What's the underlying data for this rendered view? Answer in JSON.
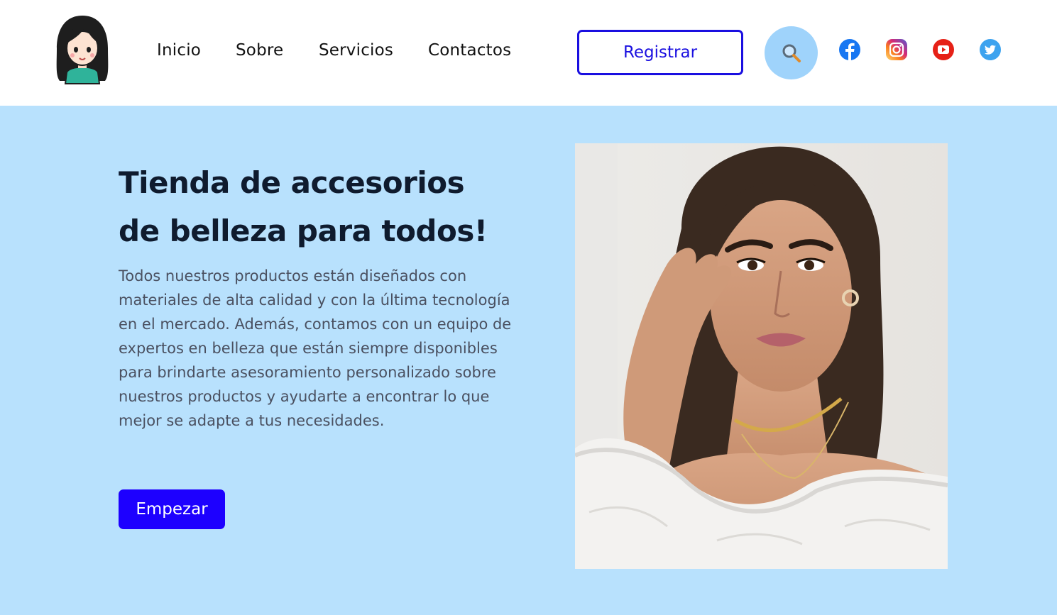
{
  "header": {
    "logo_alt": "logo",
    "nav": [
      "Inicio",
      "Sobre",
      "Servicios",
      "Contactos"
    ],
    "register_label": "Registrar",
    "search_icon": "search-icon",
    "social_icons": [
      "facebook-icon",
      "instagram-icon",
      "youtube-icon",
      "twitter-icon"
    ]
  },
  "hero": {
    "title_line1": "Tienda de accesorios",
    "title_line2": "de belleza para todos!",
    "text": "Todos nuestros productos están diseñados con materiales de alta calidad y con la última tecnología en el mercado. Además, contamos con un equipo de expertos en belleza que están siempre disponibles para brindarte asesoramiento personalizado sobre nuestros productos y ayudarte a encontrar lo que mejor se adapte a tus necesidades.",
    "cta_label": "Empezar",
    "image": "model-photo"
  },
  "colors": {
    "accent": "#1d00ff",
    "hero_bg": "#b8e1fd",
    "search_bg": "#9fd3fb",
    "heading": "#0f1b2e"
  }
}
